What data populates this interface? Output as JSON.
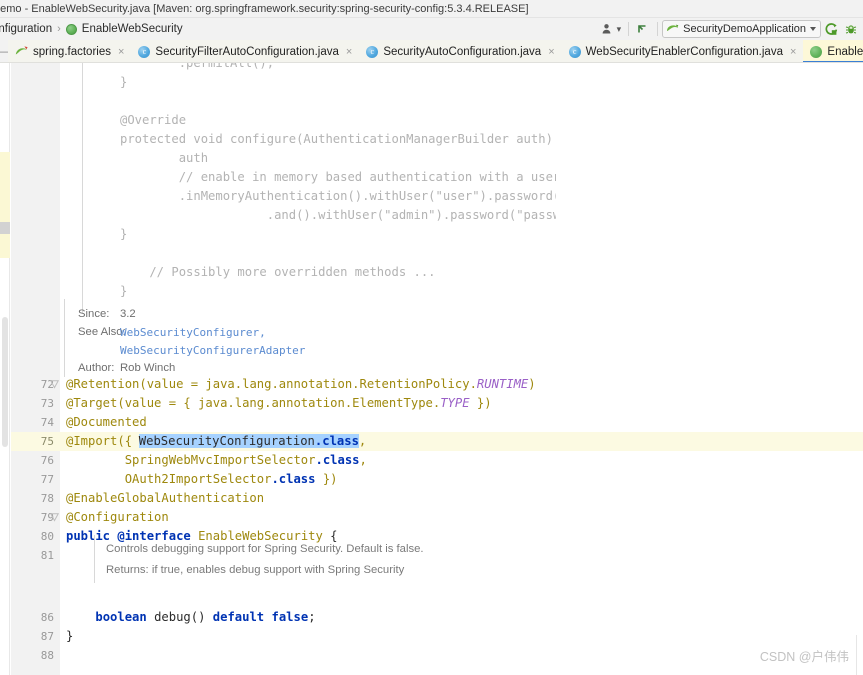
{
  "window": {
    "title": "demo - EnableWebSecurity.java [Maven: org.springframework.security:spring-security-config:5.3.4.RELEASE]"
  },
  "breadcrumb": {
    "parent": "onfiguration",
    "separator": "›",
    "current": "EnableWebSecurity",
    "current_icon": "annotation-icon"
  },
  "toolbar": {
    "profile_icon": "user-profile-icon",
    "profile_caret": "▾",
    "back_icon": "back-arrow-icon",
    "run_config": {
      "icon": "spring-boot-icon",
      "label": "SecurityDemoApplication",
      "caret": "▾"
    },
    "run_icon": "run-icon",
    "debug_icon": "debug-icon"
  },
  "tabs": {
    "lead_icon": "collapse-icon",
    "lead_glyph": "—",
    "items": [
      {
        "label": "spring.factories",
        "icon": "spring-leaf-icon",
        "close": "×",
        "selected": false
      },
      {
        "label": "SecurityFilterAutoConfiguration.java",
        "icon": "java-class-icon",
        "close": "×",
        "selected": false
      },
      {
        "label": "SecurityAutoConfiguration.java",
        "icon": "java-class-icon",
        "close": "×",
        "selected": false
      },
      {
        "label": "WebSecurityEnablerConfiguration.java",
        "icon": "java-class-icon",
        "close": "×",
        "selected": false
      },
      {
        "label": "EnableWebSecurity.java",
        "icon": "annotation-icon",
        "close": "×",
        "selected": true
      }
    ]
  },
  "editor": {
    "gutter": {
      "numbers": [
        "72",
        "73",
        "74",
        "75",
        "76",
        "77",
        "78",
        "79",
        "80",
        "81",
        "86",
        "87",
        "88"
      ],
      "highlighted": "75"
    },
    "javadoc_top": {
      "lines": [
        "        .permitAll();",
        "}",
        "",
        "@Override",
        "protected void configure(AuthenticationManagerBuilder auth) throws Excepti",
        "        auth",
        "        // enable in memory based authentication with a user named \"user\"",
        "        .inMemoryAuthentication().withUser(\"user\").password(\"password\").ro",
        "                    .and().withUser(\"admin\").password(\"password\").role",
        "}",
        "",
        "    // Possibly more overridden methods ...",
        "}"
      ]
    },
    "javadoc_tags": [
      {
        "label": "Since:",
        "value": "3.2",
        "kind": "text"
      },
      {
        "label": "See Also:",
        "value": "WebSecurityConfigurer,",
        "kind": "link"
      },
      {
        "label": "",
        "value": "WebSecurityConfigurerAdapter",
        "kind": "link"
      },
      {
        "label": "Author:",
        "value": "Rob Winch",
        "kind": "text"
      }
    ],
    "javadoc_member": {
      "lines": [
        "Controls debugging support for Spring Security. Default is false.",
        "Returns: if true, enables debug support with Spring Security"
      ]
    },
    "code_lines": [
      {
        "line": "72",
        "fold": true,
        "tokens": [
          {
            "t": "@Retention(",
            "c": "annot"
          },
          {
            "t": "value = java.lang.annotation.RetentionPolicy.",
            "c": "annot"
          },
          {
            "t": "RUNTIME",
            "c": "ital"
          },
          {
            "t": ")",
            "c": "annot"
          }
        ]
      },
      {
        "line": "73",
        "fold": false,
        "tokens": [
          {
            "t": "@Target(value = { java.lang.annotation.ElementType.",
            "c": "annot"
          },
          {
            "t": "TYPE",
            "c": "ital"
          },
          {
            "t": " })",
            "c": "annot"
          }
        ]
      },
      {
        "line": "74",
        "fold": false,
        "tokens": [
          {
            "t": "@Documented",
            "c": "annot"
          }
        ]
      },
      {
        "line": "75",
        "fold": false,
        "highlight": true,
        "tokens": [
          {
            "t": "@Import({ ",
            "c": "annot"
          },
          {
            "t": "CARET",
            "c": "caret"
          },
          {
            "t": "WebSecurityConfiguration",
            "c": "sel-plain"
          },
          {
            "t": ".class",
            "c": "sel-kw"
          },
          {
            "t": ",",
            "c": "annot"
          }
        ]
      },
      {
        "line": "76",
        "fold": false,
        "tokens": [
          {
            "t": "        SpringWebMvcImportSelector",
            "c": "annot"
          },
          {
            "t": ".class",
            "c": "kw"
          },
          {
            "t": ",",
            "c": "annot"
          }
        ]
      },
      {
        "line": "77",
        "fold": false,
        "tokens": [
          {
            "t": "        OAuth2ImportSelector",
            "c": "annot"
          },
          {
            "t": ".class",
            "c": "kw"
          },
          {
            "t": " })",
            "c": "annot"
          }
        ]
      },
      {
        "line": "78",
        "fold": false,
        "tokens": [
          {
            "t": "@EnableGlobalAuthentication",
            "c": "annot"
          }
        ]
      },
      {
        "line": "79",
        "fold": true,
        "tokens": [
          {
            "t": "@Configuration",
            "c": "annot"
          }
        ]
      },
      {
        "line": "80",
        "fold": false,
        "tokens": [
          {
            "t": "public ",
            "c": "kw"
          },
          {
            "t": "@interface",
            "c": "kw"
          },
          {
            "t": " ",
            "c": "plain"
          },
          {
            "t": "EnableWebSecurity",
            "c": "annot"
          },
          {
            "t": " {",
            "c": "plain"
          }
        ]
      },
      {
        "line": "81",
        "fold": false,
        "tokens": []
      },
      {
        "line": "86",
        "fold": false,
        "tokens": [
          {
            "t": "    ",
            "c": "plain"
          },
          {
            "t": "boolean",
            "c": "kw"
          },
          {
            "t": " ",
            "c": "plain"
          },
          {
            "t": "debug",
            "c": "cls"
          },
          {
            "t": "() ",
            "c": "plain"
          },
          {
            "t": "default",
            "c": "kw"
          },
          {
            "t": " ",
            "c": "plain"
          },
          {
            "t": "false",
            "c": "kw"
          },
          {
            "t": ";",
            "c": "plain"
          }
        ]
      },
      {
        "line": "87",
        "fold": false,
        "tokens": [
          {
            "t": "}",
            "c": "plain"
          }
        ]
      },
      {
        "line": "88",
        "fold": false,
        "tokens": []
      }
    ]
  },
  "watermark": {
    "text": "CSDN @户伟伟"
  },
  "colors": {
    "annotation": "#9e880d",
    "keyword": "#0033b3",
    "selection": "#a6d2ff",
    "doc_gray": "#b3b3b3",
    "link": "#5b8bd0",
    "tab_selected_bg": "#fdf8d8",
    "tab_underline": "#3a7fd5",
    "line_highlight": "#fcfae2"
  }
}
